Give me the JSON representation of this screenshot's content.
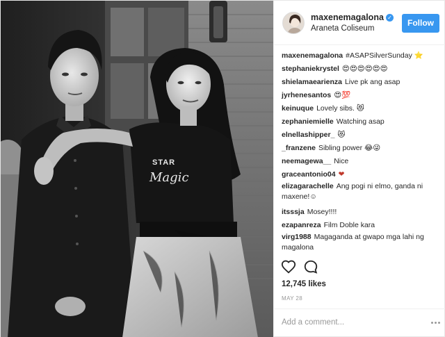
{
  "header": {
    "username": "maxenemagalona",
    "location": "Araneta Coliseum",
    "follow_label": "Follow"
  },
  "comments": [
    {
      "user": "maxenemagalona",
      "text": "#ASAPSilverSunday ⭐"
    },
    {
      "user": "stephaniekrystel",
      "text": "😍😍😍😍😍😍"
    },
    {
      "user": "shielamaearienza",
      "text": "Live pk ang asap"
    },
    {
      "user": "jyrhenesantos",
      "text": "😍💯"
    },
    {
      "user": "keinuque",
      "text": "Lovely sibs. 😻"
    },
    {
      "user": "zephaniemielle",
      "text": "Watching asap"
    },
    {
      "user": "elnellashipper_",
      "text": "😻"
    },
    {
      "user": "_franzene",
      "text": "Sibling power 😂😜"
    },
    {
      "user": "neemagewa__",
      "text": "Nice"
    },
    {
      "user": "graceantonio04",
      "text": "❤"
    },
    {
      "user": "elizagarachelle",
      "text": "Ang pogi ni elmo, ganda ni maxene!☺"
    },
    {
      "user": "itsssja",
      "text": "Mosey!!!!"
    },
    {
      "user": "ezapanreza",
      "text": "Film Doble kara"
    },
    {
      "user": "virg1988",
      "text": "Magaganda at gwapo mga lahi ng magalona"
    }
  ],
  "likes": "12,745 likes",
  "date": "MAY 28",
  "add_comment_placeholder": "Add a comment...",
  "colors": {
    "accent": "#3897f0",
    "text": "#262626",
    "muted": "#999999",
    "border": "#efefef",
    "heart_emoji": "#c0392b"
  },
  "icons": {
    "like": "heart-outline-icon",
    "comment": "speech-bubble-icon",
    "verified": "verified-badge-icon",
    "more": "ellipsis-icon"
  },
  "photo": {
    "shirt_lettering": "STAR Magic"
  }
}
